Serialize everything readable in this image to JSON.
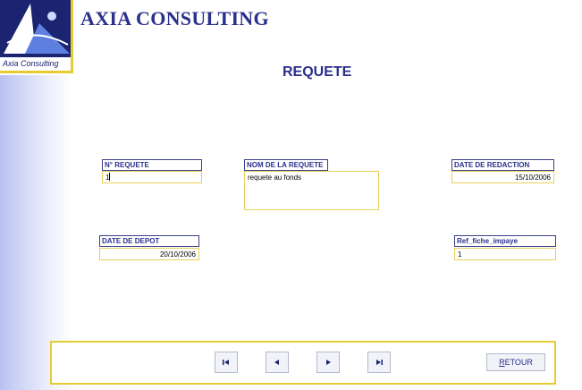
{
  "brand": {
    "logo_text": "Axia Consulting",
    "title": "AXIA CONSULTING"
  },
  "page": {
    "title": "REQUETE"
  },
  "fields": {
    "numero": {
      "label": "N° REQUETE",
      "value": "1"
    },
    "nom": {
      "label": "NOM DE LA REQUETE",
      "value": "requete au fonds"
    },
    "date_redaction": {
      "label": "DATE DE REDACTION",
      "value": "15/10/2006"
    },
    "date_depot": {
      "label": "DATE DE DEPOT",
      "value": "20/10/2006"
    },
    "ref_fiche": {
      "label": "Ref_fiche_impaye",
      "value": "1"
    }
  },
  "navigation": {
    "retour_first": "R",
    "retour_rest": "ETOUR",
    "icons": [
      "first-record-icon",
      "previous-record-icon",
      "next-record-icon",
      "last-record-icon"
    ]
  },
  "colors": {
    "accent": "#2a2f8c",
    "border_yellow": "#e6cc33",
    "side_gradient": "#b8c2f2"
  }
}
